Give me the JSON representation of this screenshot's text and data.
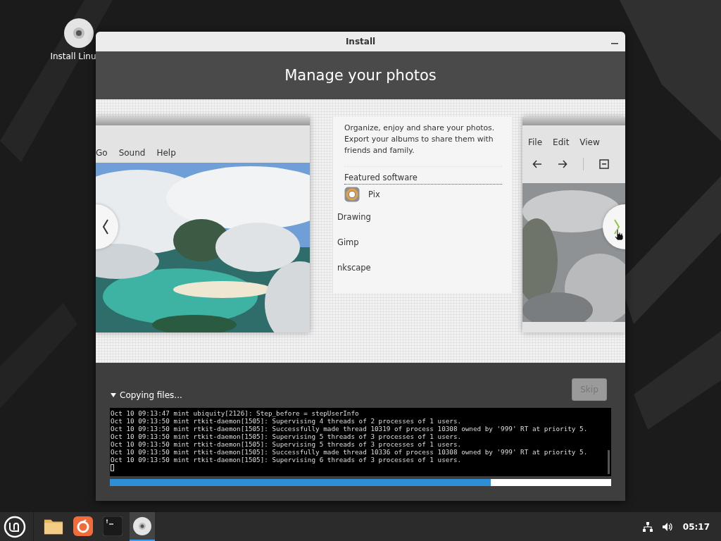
{
  "desktop": {
    "icons": [
      {
        "label": "Install Linu"
      }
    ]
  },
  "window": {
    "title": "Install",
    "heading": "Manage your photos"
  },
  "slideshow": {
    "left_screenshot": {
      "menu": [
        "Go",
        "Sound",
        "Help"
      ]
    },
    "description": "Organize, enjoy and share your photos. Export your albums to share them with friends and family.",
    "featured_heading": "Featured software",
    "software": [
      {
        "name": "Pix",
        "kind": "with-icon"
      },
      {
        "name": "Drawing",
        "kind": "plain"
      },
      {
        "name": "Gimp",
        "kind": "plain"
      },
      {
        "name": "nkscape",
        "kind": "plain"
      }
    ],
    "right_screenshot": {
      "menu": [
        "File",
        "Edit",
        "View"
      ]
    }
  },
  "progress": {
    "status": "Copying files...",
    "expanded": true,
    "skip_button": {
      "label": "Skip",
      "disabled": true
    },
    "log": [
      "Oct 10 09:13:47 mint ubiquity[2126]: Step_before = stepUserInfo",
      "Oct 10 09:13:50 mint rtkit-daemon[1505]: Supervising 4 threads of 2 processes of 1 users.",
      "Oct 10 09:13:50 mint rtkit-daemon[1505]: Successfully made thread 10319 of process 10308 owned by '999' RT at priority 5.",
      "Oct 10 09:13:50 mint rtkit-daemon[1505]: Supervising 5 threads of 3 processes of 1 users.",
      "Oct 10 09:13:50 mint rtkit-daemon[1505]: Supervising 5 threads of 3 processes of 1 users.",
      "Oct 10 09:13:50 mint rtkit-daemon[1505]: Successfully made thread 10336 of process 10308 owned by '999' RT at priority 5.",
      "Oct 10 09:13:50 mint rtkit-daemon[1505]: Supervising 6 threads of 3 processes of 1 users."
    ],
    "level": 0.76
  },
  "taskbar": {
    "apps": [
      {
        "kind": "files",
        "selected": false
      },
      {
        "kind": "browser",
        "selected": false
      },
      {
        "kind": "terminal",
        "selected": false
      },
      {
        "kind": "disc",
        "selected": true
      }
    ],
    "clock": "05:17"
  }
}
